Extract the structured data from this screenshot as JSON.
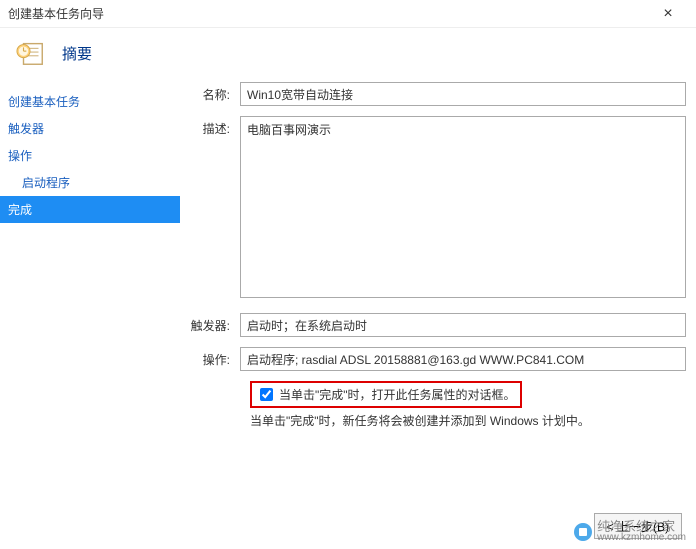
{
  "window": {
    "title": "创建基本任务向导"
  },
  "header": {
    "title": "摘要"
  },
  "sidebar": {
    "items": [
      {
        "label": "创建基本任务"
      },
      {
        "label": "触发器"
      },
      {
        "label": "操作"
      },
      {
        "label": "启动程序"
      },
      {
        "label": "完成"
      }
    ]
  },
  "form": {
    "name_label": "名称:",
    "name_value": "Win10宽带自动连接",
    "desc_label": "描述:",
    "desc_value": "电脑百事网演示",
    "trigger_label": "触发器:",
    "trigger_value": "启动时；在系统启动时",
    "action_label": "操作:",
    "action_value": "启动程序; rasdial ADSL 20158881@163.gd WWW.PC841.COM",
    "checkbox_label": "当单击\"完成\"时，打开此任务属性的对话框。",
    "note": "当单击\"完成\"时，新任务将会被创建并添加到 Windows 计划中。"
  },
  "footer": {
    "back": "< 上一步(B)"
  },
  "watermark": {
    "brand": "纯净系统之家",
    "site": "www.kzmhome.com"
  }
}
